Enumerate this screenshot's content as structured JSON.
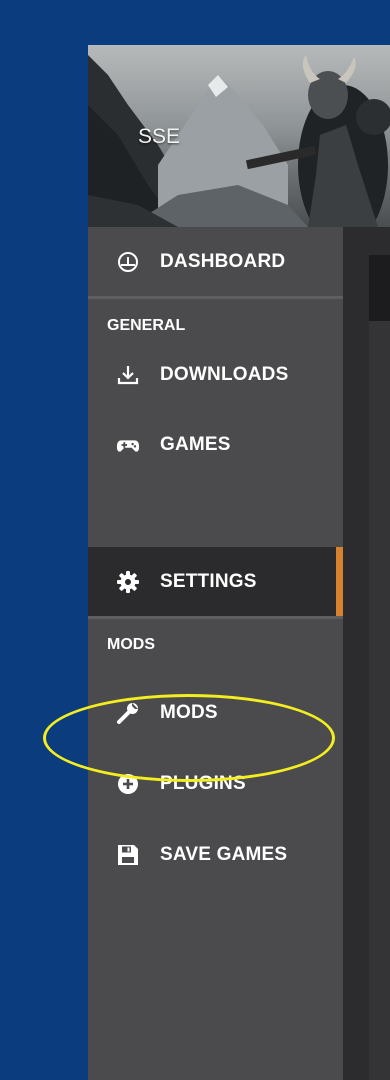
{
  "header": {
    "game_tag": "SSE"
  },
  "nav": {
    "dashboard": "DASHBOARD",
    "general_label": "GENERAL",
    "downloads": "DOWNLOADS",
    "games": "GAMES",
    "settings": "SETTINGS",
    "mods_label": "MODS",
    "mods": "MODS",
    "plugins": "PLUGINS",
    "save_games": "SAVE GAMES"
  },
  "active_item": "SETTINGS",
  "icons": {
    "dashboard": "dashboard-gauge-icon",
    "downloads": "download-icon",
    "games": "gamepad-icon",
    "settings": "gear-icon",
    "mods": "wrench-icon",
    "plugins": "plus-circle-icon",
    "save_games": "floppy-disk-icon"
  },
  "colors": {
    "background": "#0b3d7e",
    "sidebar": "#4b4a4c",
    "active_item": "#2b2b2d",
    "active_accent": "#d7822f",
    "annotation": "#f3ee1f"
  }
}
